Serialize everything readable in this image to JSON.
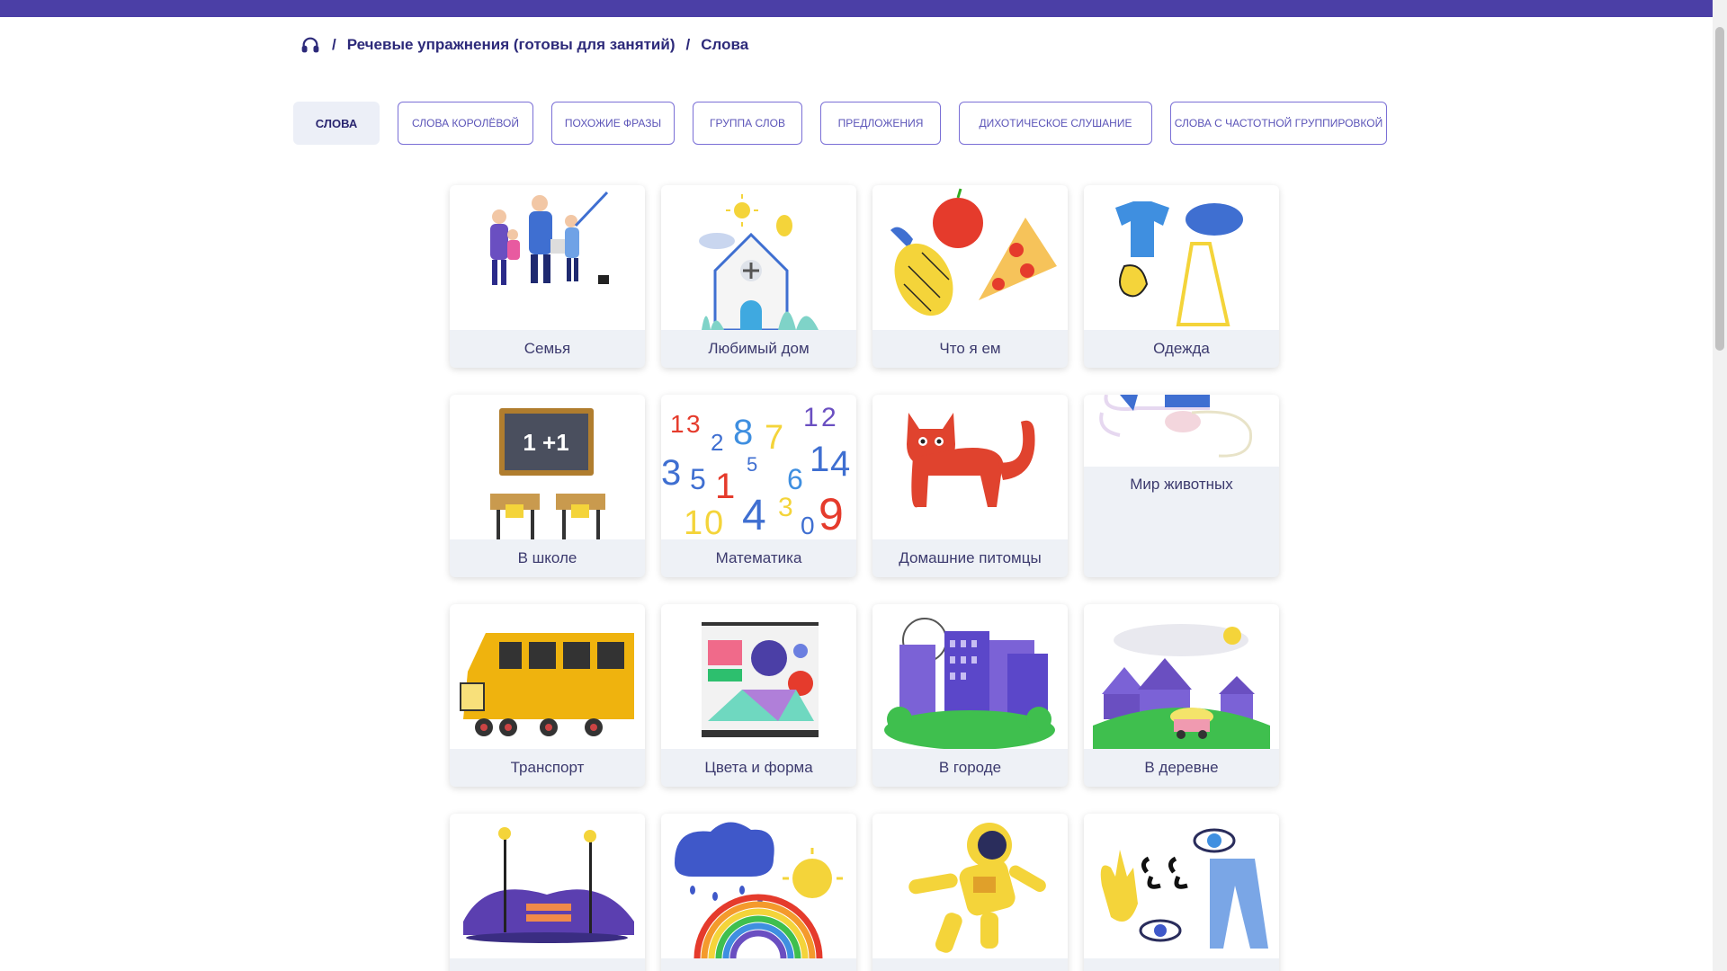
{
  "breadcrumb": {
    "home_icon": "headphones-icon",
    "items": [
      "Речевые упражнения (готовы для занятий)",
      "Слова"
    ],
    "separator": "/"
  },
  "tabs": [
    {
      "label": "СЛОВА",
      "active": true
    },
    {
      "label": "СЛОВА КОРОЛЁВОЙ",
      "active": false
    },
    {
      "label": "ПОХОЖИЕ ФРАЗЫ",
      "active": false
    },
    {
      "label": "ГРУППА СЛОВ",
      "active": false
    },
    {
      "label": "ПРЕДЛОЖЕНИЯ",
      "active": false
    },
    {
      "label": "ДИХОТИЧЕСКОЕ СЛУШАНИЕ",
      "active": false
    },
    {
      "label": "СЛОВА С ЧАСТОТНОЙ ГРУППИРОВКОЙ",
      "active": false
    }
  ],
  "cards": [
    {
      "label": "Семья",
      "image": "family-image"
    },
    {
      "label": "Любимый дом",
      "image": "house-image"
    },
    {
      "label": "Что я ем",
      "image": "food-image"
    },
    {
      "label": "Одежда",
      "image": "clothes-image"
    },
    {
      "label": "В школе",
      "image": "school-image"
    },
    {
      "label": "Математика",
      "image": "numbers-image"
    },
    {
      "label": "Домашние питомцы",
      "image": "cat-image"
    },
    {
      "label": "Мир животных",
      "image": "animals-image"
    },
    {
      "label": "Транспорт",
      "image": "bus-image"
    },
    {
      "label": "Цвета и форма",
      "image": "shapes-image"
    },
    {
      "label": "В городе",
      "image": "city-image"
    },
    {
      "label": "В деревне",
      "image": "village-image"
    },
    {
      "label": "",
      "image": "park-image"
    },
    {
      "label": "",
      "image": "weather-image"
    },
    {
      "label": "",
      "image": "astronaut-image"
    },
    {
      "label": "",
      "image": "body-parts-image"
    }
  ],
  "colors": {
    "topbar": "#4b3fa6",
    "accent": "#7a6fd6",
    "text": "#2d2a7a"
  }
}
